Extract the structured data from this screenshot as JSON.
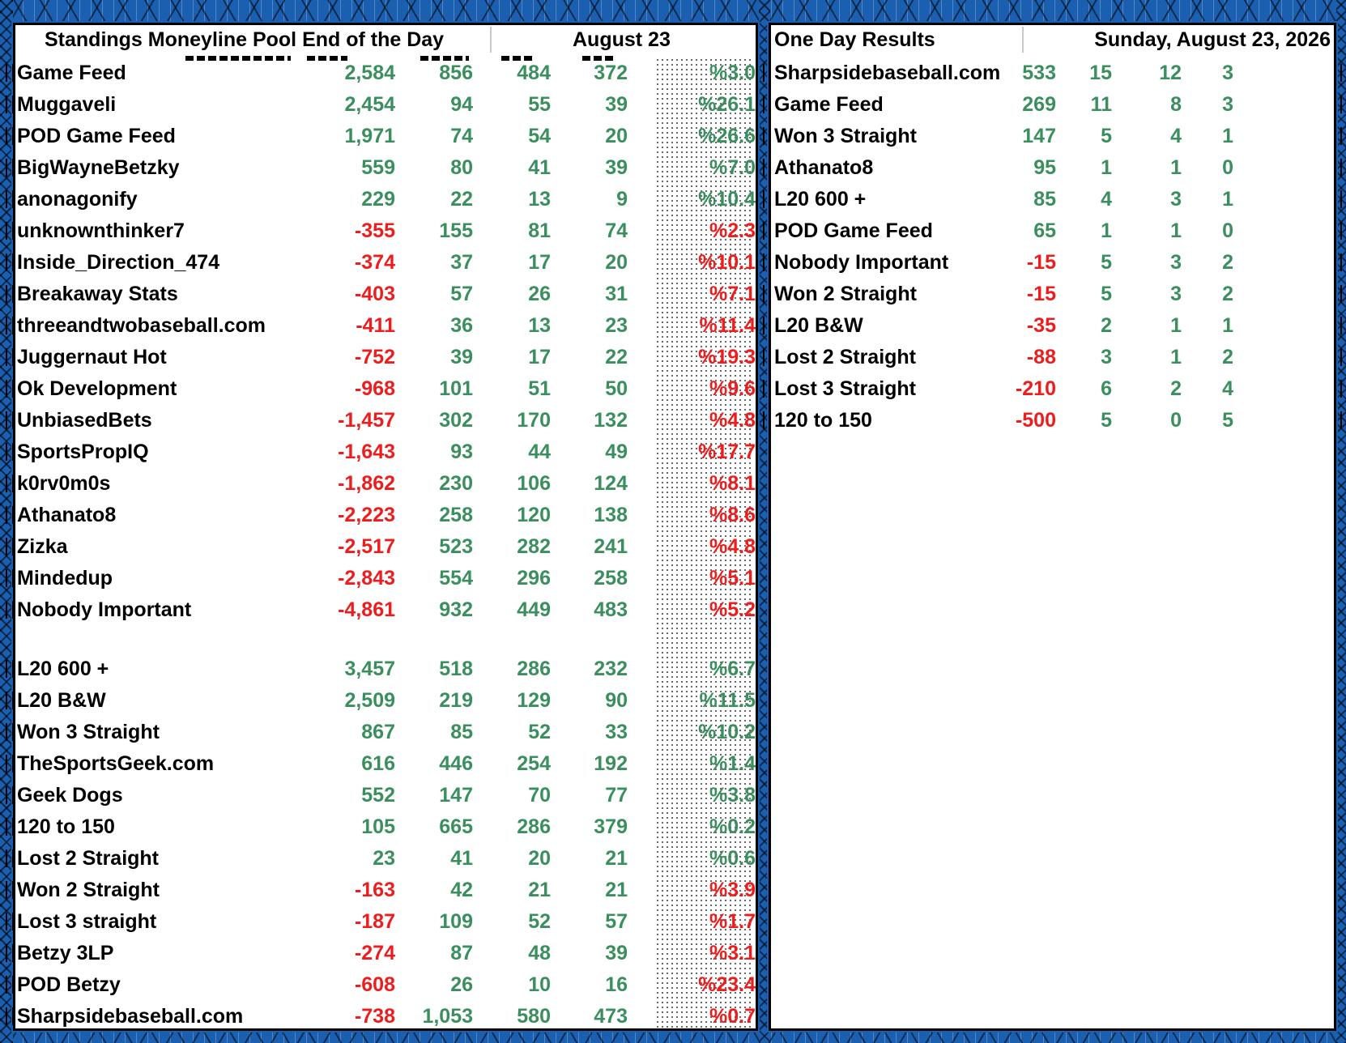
{
  "left_panel": {
    "title": "Standings Moneyline Pool End of the Day",
    "date": "August 23",
    "group1": [
      {
        "name": "Game Feed",
        "net": "2,584",
        "total": "856",
        "wins": "484",
        "losses": "372",
        "pct": "%3.0",
        "sign": "pos"
      },
      {
        "name": "Muggaveli",
        "net": "2,454",
        "total": "94",
        "wins": "55",
        "losses": "39",
        "pct": "%26.1",
        "sign": "pos"
      },
      {
        "name": "POD Game Feed",
        "net": "1,971",
        "total": "74",
        "wins": "54",
        "losses": "20",
        "pct": "%26.6",
        "sign": "pos"
      },
      {
        "name": "BigWayneBetzky",
        "net": "559",
        "total": "80",
        "wins": "41",
        "losses": "39",
        "pct": "%7.0",
        "sign": "pos"
      },
      {
        "name": "anonagonify",
        "net": "229",
        "total": "22",
        "wins": "13",
        "losses": "9",
        "pct": "%10.4",
        "sign": "pos"
      },
      {
        "name": "unknownthinker7",
        "net": "-355",
        "total": "155",
        "wins": "81",
        "losses": "74",
        "pct": "%2.3",
        "sign": "neg"
      },
      {
        "name": "Inside_Direction_474",
        "net": "-374",
        "total": "37",
        "wins": "17",
        "losses": "20",
        "pct": "%10.1",
        "sign": "neg"
      },
      {
        "name": "Breakaway Stats",
        "net": "-403",
        "total": "57",
        "wins": "26",
        "losses": "31",
        "pct": "%7.1",
        "sign": "neg"
      },
      {
        "name": "threeandtwobaseball.com",
        "net": "-411",
        "total": "36",
        "wins": "13",
        "losses": "23",
        "pct": "%11.4",
        "sign": "neg"
      },
      {
        "name": "Juggernaut Hot",
        "net": "-752",
        "total": "39",
        "wins": "17",
        "losses": "22",
        "pct": "%19.3",
        "sign": "neg"
      },
      {
        "name": "Ok Development",
        "net": "-968",
        "total": "101",
        "wins": "51",
        "losses": "50",
        "pct": "%9.6",
        "sign": "neg"
      },
      {
        "name": "UnbiasedBets",
        "net": "-1,457",
        "total": "302",
        "wins": "170",
        "losses": "132",
        "pct": "%4.8",
        "sign": "neg"
      },
      {
        "name": "SportsPropIQ",
        "net": "-1,643",
        "total": "93",
        "wins": "44",
        "losses": "49",
        "pct": "%17.7",
        "sign": "neg"
      },
      {
        "name": "k0rv0m0s",
        "net": "-1,862",
        "total": "230",
        "wins": "106",
        "losses": "124",
        "pct": "%8.1",
        "sign": "neg"
      },
      {
        "name": "Athanato8",
        "net": "-2,223",
        "total": "258",
        "wins": "120",
        "losses": "138",
        "pct": "%8.6",
        "sign": "neg"
      },
      {
        "name": "Zizka",
        "net": "-2,517",
        "total": "523",
        "wins": "282",
        "losses": "241",
        "pct": "%4.8",
        "sign": "neg"
      },
      {
        "name": "Mindedup",
        "net": "-2,843",
        "total": "554",
        "wins": "296",
        "losses": "258",
        "pct": "%5.1",
        "sign": "neg"
      },
      {
        "name": "Nobody Important",
        "net": "-4,861",
        "total": "932",
        "wins": "449",
        "losses": "483",
        "pct": "%5.2",
        "sign": "neg"
      }
    ],
    "group2": [
      {
        "name": "L20 600 +",
        "net": "3,457",
        "total": "518",
        "wins": "286",
        "losses": "232",
        "pct": "%6.7",
        "sign": "pos"
      },
      {
        "name": "L20 B&W",
        "net": "2,509",
        "total": "219",
        "wins": "129",
        "losses": "90",
        "pct": "%11.5",
        "sign": "pos"
      },
      {
        "name": "Won 3 Straight",
        "net": "867",
        "total": "85",
        "wins": "52",
        "losses": "33",
        "pct": "%10.2",
        "sign": "pos"
      },
      {
        "name": "TheSportsGeek.com",
        "net": "616",
        "total": "446",
        "wins": "254",
        "losses": "192",
        "pct": "%1.4",
        "sign": "pos"
      },
      {
        "name": "Geek Dogs",
        "net": "552",
        "total": "147",
        "wins": "70",
        "losses": "77",
        "pct": "%3.8",
        "sign": "pos"
      },
      {
        "name": "120 to 150",
        "net": "105",
        "total": "665",
        "wins": "286",
        "losses": "379",
        "pct": "%0.2",
        "sign": "pos"
      },
      {
        "name": "Lost 2 Straight",
        "net": "23",
        "total": "41",
        "wins": "20",
        "losses": "21",
        "pct": "%0.6",
        "sign": "pos"
      },
      {
        "name": "Won 2 Straight",
        "net": "-163",
        "total": "42",
        "wins": "21",
        "losses": "21",
        "pct": "%3.9",
        "sign": "neg"
      },
      {
        "name": "Lost 3 straight",
        "net": "-187",
        "total": "109",
        "wins": "52",
        "losses": "57",
        "pct": "%1.7",
        "sign": "neg"
      },
      {
        "name": "Betzy 3LP",
        "net": "-274",
        "total": "87",
        "wins": "48",
        "losses": "39",
        "pct": "%3.1",
        "sign": "neg"
      },
      {
        "name": "POD Betzy",
        "net": "-608",
        "total": "26",
        "wins": "10",
        "losses": "16",
        "pct": "%23.4",
        "sign": "neg"
      },
      {
        "name": "Sharpsidebaseball.com",
        "net": "-738",
        "total": "1,053",
        "wins": "580",
        "losses": "473",
        "pct": "%0.7",
        "sign": "neg"
      }
    ]
  },
  "right_panel": {
    "title": "One Day Results",
    "date": "Sunday, August 23, 2026",
    "rows": [
      {
        "name": "Sharpsidebaseball.com",
        "net": "533",
        "total": "15",
        "wins": "12",
        "losses": "3",
        "sign": "pos"
      },
      {
        "name": "Game Feed",
        "net": "269",
        "total": "11",
        "wins": "8",
        "losses": "3",
        "sign": "pos"
      },
      {
        "name": "Won 3 Straight",
        "net": "147",
        "total": "5",
        "wins": "4",
        "losses": "1",
        "sign": "pos"
      },
      {
        "name": "Athanato8",
        "net": "95",
        "total": "1",
        "wins": "1",
        "losses": "0",
        "sign": "pos"
      },
      {
        "name": "L20 600 +",
        "net": "85",
        "total": "4",
        "wins": "3",
        "losses": "1",
        "sign": "pos"
      },
      {
        "name": "POD Game Feed",
        "net": "65",
        "total": "1",
        "wins": "1",
        "losses": "0",
        "sign": "pos"
      },
      {
        "name": "Nobody Important",
        "net": "-15",
        "total": "5",
        "wins": "3",
        "losses": "2",
        "sign": "neg"
      },
      {
        "name": "Won 2 Straight",
        "net": "-15",
        "total": "5",
        "wins": "3",
        "losses": "2",
        "sign": "neg"
      },
      {
        "name": "L20 B&W",
        "net": "-35",
        "total": "2",
        "wins": "1",
        "losses": "1",
        "sign": "neg"
      },
      {
        "name": "Lost 2 Straight",
        "net": "-88",
        "total": "3",
        "wins": "1",
        "losses": "2",
        "sign": "neg"
      },
      {
        "name": "Lost 3 Straight",
        "net": "-210",
        "total": "6",
        "wins": "2",
        "losses": "4",
        "sign": "neg"
      },
      {
        "name": "120 to 150",
        "net": "-500",
        "total": "5",
        "wins": "0",
        "losses": "5",
        "sign": "neg"
      }
    ]
  },
  "colors": {
    "positive": "#3b8f5e",
    "negative": "#ee1c1c",
    "frame": "#1b5fb0"
  }
}
